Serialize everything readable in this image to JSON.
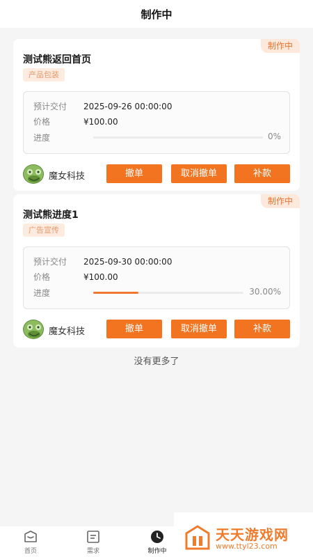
{
  "header": {
    "title": "制作中"
  },
  "orders": [
    {
      "status_badge": "制作中",
      "title": "测试熊返回首页",
      "tag": "产品包装",
      "delivery_label": "预计交付",
      "delivery_value": "2025-09-26 00:00:00",
      "price_label": "价格",
      "price_value": "¥100.00",
      "progress_label": "进度",
      "progress_text": "0%",
      "progress_fraction": 0,
      "company": "魔女科技",
      "btn_withdraw": "撤单",
      "btn_cancel_withdraw": "取消撤单",
      "btn_supplement": "补款"
    },
    {
      "status_badge": "制作中",
      "title": "测试熊进度1",
      "tag": "广告宣传",
      "delivery_label": "预计交付",
      "delivery_value": "2025-09-30 00:00:00",
      "price_label": "价格",
      "price_value": "¥100.00",
      "progress_label": "进度",
      "progress_text": "30.00%",
      "progress_fraction": 0.3,
      "company": "魔女科技",
      "btn_withdraw": "撤单",
      "btn_cancel_withdraw": "取消撤单",
      "btn_supplement": "补款"
    }
  ],
  "no_more_text": "没有更多了",
  "tabbar": {
    "items": [
      {
        "label": "首页",
        "icon": "home-icon"
      },
      {
        "label": "需求",
        "icon": "list-icon"
      },
      {
        "label": "制作中",
        "icon": "clock-icon"
      }
    ]
  },
  "watermark": {
    "name": "天天游戏网",
    "url": "www.ttyl23.com"
  },
  "colors": {
    "accent": "#f27420",
    "badge_bg": "#fde9dc",
    "tag_bg": "#fdebdf"
  }
}
